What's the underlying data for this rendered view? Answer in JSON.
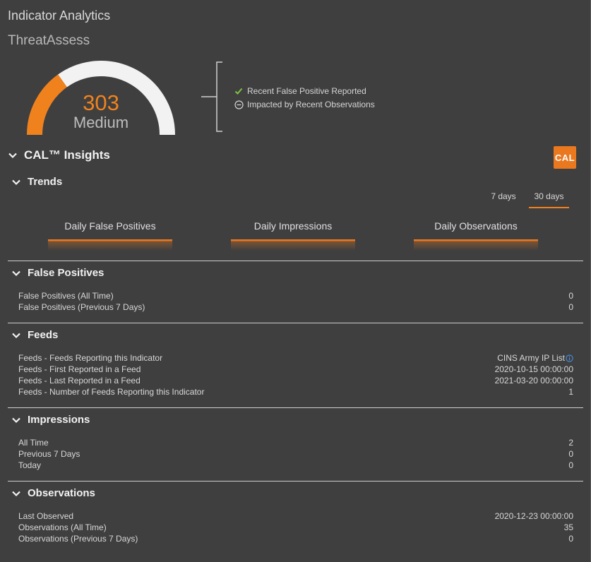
{
  "header": {
    "title": "Indicator Analytics",
    "subtitle": "ThreatAssess"
  },
  "gauge": {
    "score": "303",
    "level": "Medium",
    "fraction": 0.303,
    "fill_color": "#f0821e",
    "track_color": "#f2f2f2"
  },
  "factors": [
    {
      "icon": "check-icon",
      "label": "Recent False Positive Reported"
    },
    {
      "icon": "minus-circle-icon",
      "label": "Impacted by Recent Observations"
    }
  ],
  "insights": {
    "title": "CAL™ Insights",
    "logo_text": "CAL",
    "accent_color": "#e9781f"
  },
  "trends": {
    "title": "Trends",
    "ranges": [
      "7 days",
      "30 days"
    ],
    "active_range": "30 days",
    "metrics": [
      "Daily False Positives",
      "Daily Impressions",
      "Daily Observations"
    ]
  },
  "false_positives": {
    "title": "False Positives",
    "rows": [
      {
        "label": "False Positives (All Time)",
        "value": "0"
      },
      {
        "label": "False Positives (Previous 7 Days)",
        "value": "0"
      }
    ]
  },
  "feeds": {
    "title": "Feeds",
    "rows": [
      {
        "label": "Feeds - Feeds Reporting this Indicator",
        "value": "CINS Army IP List"
      },
      {
        "label": "Feeds - First Reported in a Feed",
        "value": "2020-10-15 00:00:00"
      },
      {
        "label": "Feeds - Last Reported in a Feed",
        "value": "2021-03-20 00:00:00"
      },
      {
        "label": "Feeds - Number of Feeds Reporting this Indicator",
        "value": "1"
      }
    ]
  },
  "impressions": {
    "title": "Impressions",
    "rows": [
      {
        "label": "All Time",
        "value": "2"
      },
      {
        "label": "Previous 7 Days",
        "value": "0"
      },
      {
        "label": "Today",
        "value": "0"
      }
    ]
  },
  "observations": {
    "title": "Observations",
    "rows": [
      {
        "label": "Last Observed",
        "value": "2020-12-23 00:00:00"
      },
      {
        "label": "Observations (All Time)",
        "value": "35"
      },
      {
        "label": "Observations (Previous 7 Days)",
        "value": "0"
      }
    ]
  }
}
